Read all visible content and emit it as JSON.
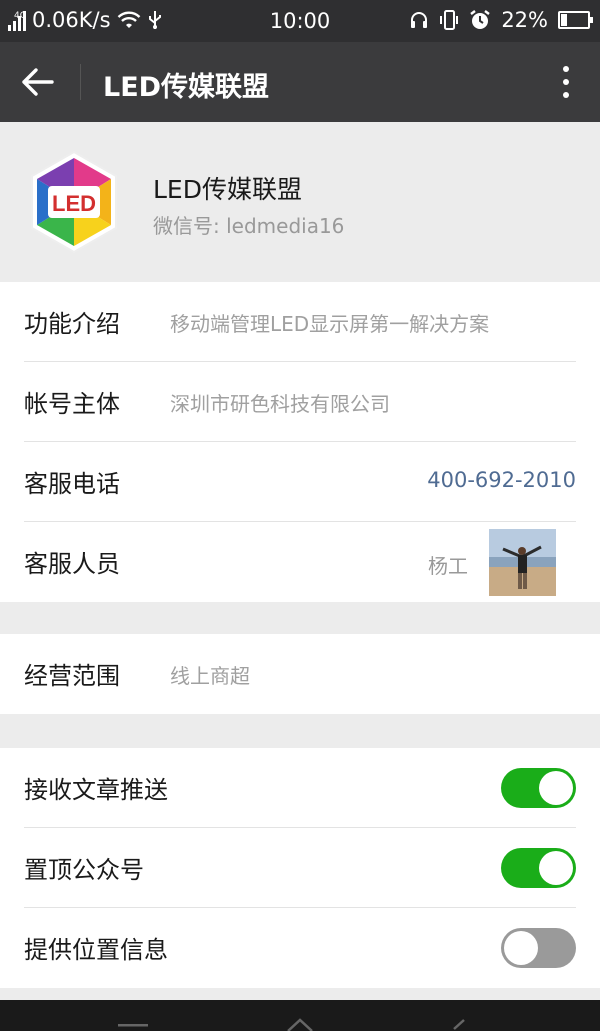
{
  "status_bar": {
    "network_type": "4G",
    "speed": "0.06K/s",
    "time": "10:00",
    "battery": "22%",
    "battery_level": 0.22,
    "icons": [
      "signal-icon",
      "wifi-icon",
      "usb-icon",
      "headset-icon",
      "vibrate-icon",
      "alarm-icon",
      "battery-icon"
    ]
  },
  "header": {
    "title": "LED传媒联盟",
    "back_icon": "back-arrow-icon",
    "more_icon": "more-vertical-icon"
  },
  "profile": {
    "logo_text": "LED",
    "name": "LED传媒联盟",
    "wechat_id": "微信号: ledmedia16"
  },
  "info": {
    "intro_label": "功能介绍",
    "intro_value": "移动端管理LED显示屏第一解决方案",
    "owner_label": "帐号主体",
    "owner_value": "深圳市研色科技有限公司",
    "phone_label": "客服电话",
    "phone_value": "400-692-2010",
    "agent_label": "客服人员",
    "agent_name": "杨工"
  },
  "business": {
    "scope_label": "经营范围",
    "scope_value": "线上商超"
  },
  "settings": {
    "items": [
      {
        "label": "接收文章推送",
        "enabled": true
      },
      {
        "label": "置顶公众号",
        "enabled": true
      },
      {
        "label": "提供位置信息",
        "enabled": false
      }
    ]
  },
  "colors": {
    "accent_green": "#1aad19",
    "toggle_off": "#9a9a9a",
    "link_blue": "#4f6b92",
    "title_bar": "#3b3b3d"
  }
}
